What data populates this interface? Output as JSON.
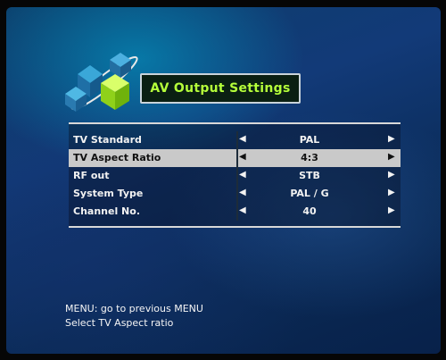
{
  "title": "AV Output Settings",
  "settings": [
    {
      "label": "TV Standard",
      "value": "PAL",
      "selected": false
    },
    {
      "label": "TV Aspect Ratio",
      "value": "4:3",
      "selected": true
    },
    {
      "label": "RF out",
      "value": "STB",
      "selected": false
    },
    {
      "label": "System Type",
      "value": "PAL / G",
      "selected": false
    },
    {
      "label": "Channel No.",
      "value": "40",
      "selected": false
    }
  ],
  "arrows": {
    "left": "◀",
    "right": "▶"
  },
  "footer": {
    "line1": "MENU: go to previous MENU",
    "line2": "Select TV Aspect ratio"
  },
  "colors": {
    "title_text": "#b5ff3a",
    "selected_row_bg": "#c9c9c9",
    "background": "#123a78"
  }
}
